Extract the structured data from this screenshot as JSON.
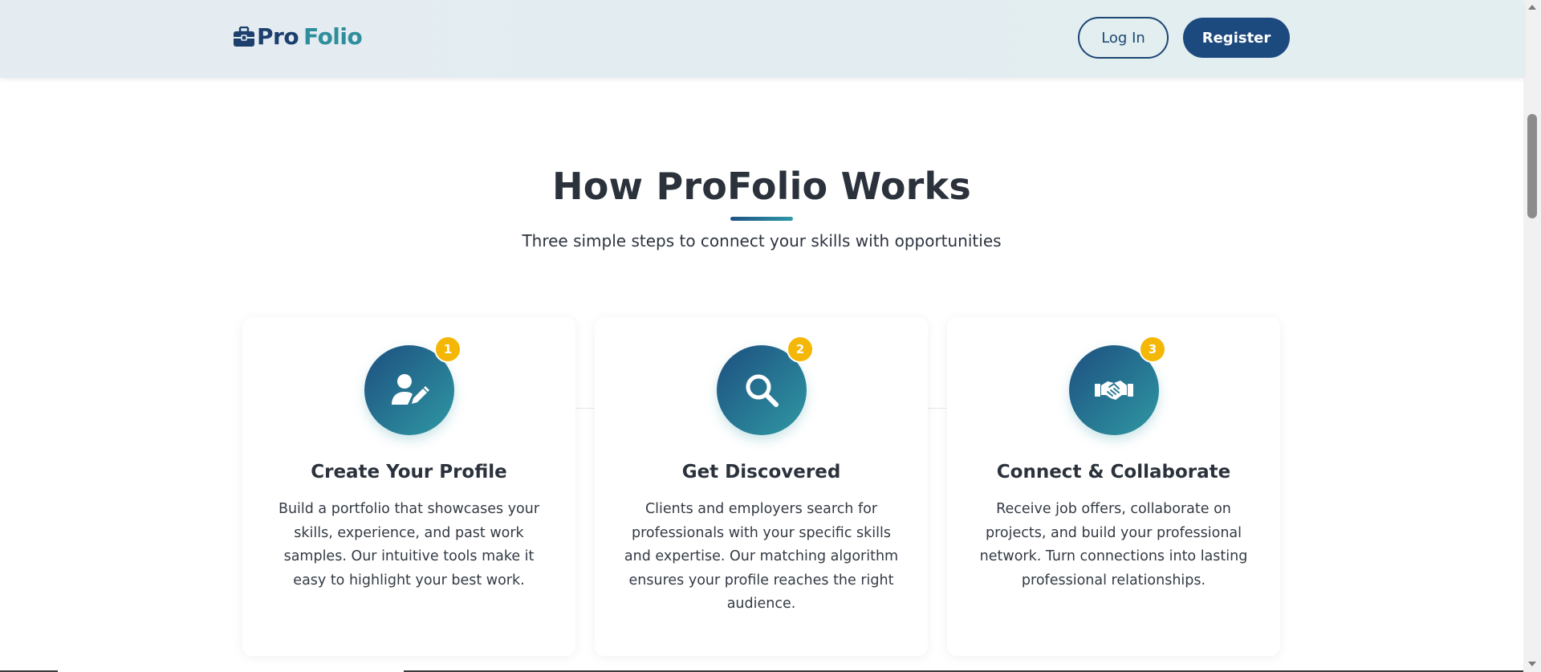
{
  "header": {
    "logo_pro": "Pro",
    "logo_folio": "Folio",
    "logo_icon": "briefcase-icon",
    "login_label": "Log In",
    "register_label": "Register"
  },
  "section": {
    "title": "How ProFolio Works",
    "subtitle": "Three simple steps to connect your skills with opportunities"
  },
  "steps": [
    {
      "number": "1",
      "icon": "user-edit-icon",
      "title": "Create Your Profile",
      "text": "Build a portfolio that showcases your skills, experience, and past work samples. Our intuitive tools make it easy to highlight your best work."
    },
    {
      "number": "2",
      "icon": "search-icon",
      "title": "Get Discovered",
      "text": "Clients and employers search for professionals with your specific skills and expertise. Our matching algorithm ensures your profile reaches the right audience."
    },
    {
      "number": "3",
      "icon": "handshake-icon",
      "title": "Connect & Collaborate",
      "text": "Receive job offers, collaborate on projects, and build your professional network. Turn connections into lasting professional relationships."
    }
  ],
  "colors": {
    "brand_navy": "#1d4a7e",
    "brand_teal": "#2e8e9c",
    "badge_yellow": "#f5b705",
    "heading_text": "#2b323c"
  }
}
